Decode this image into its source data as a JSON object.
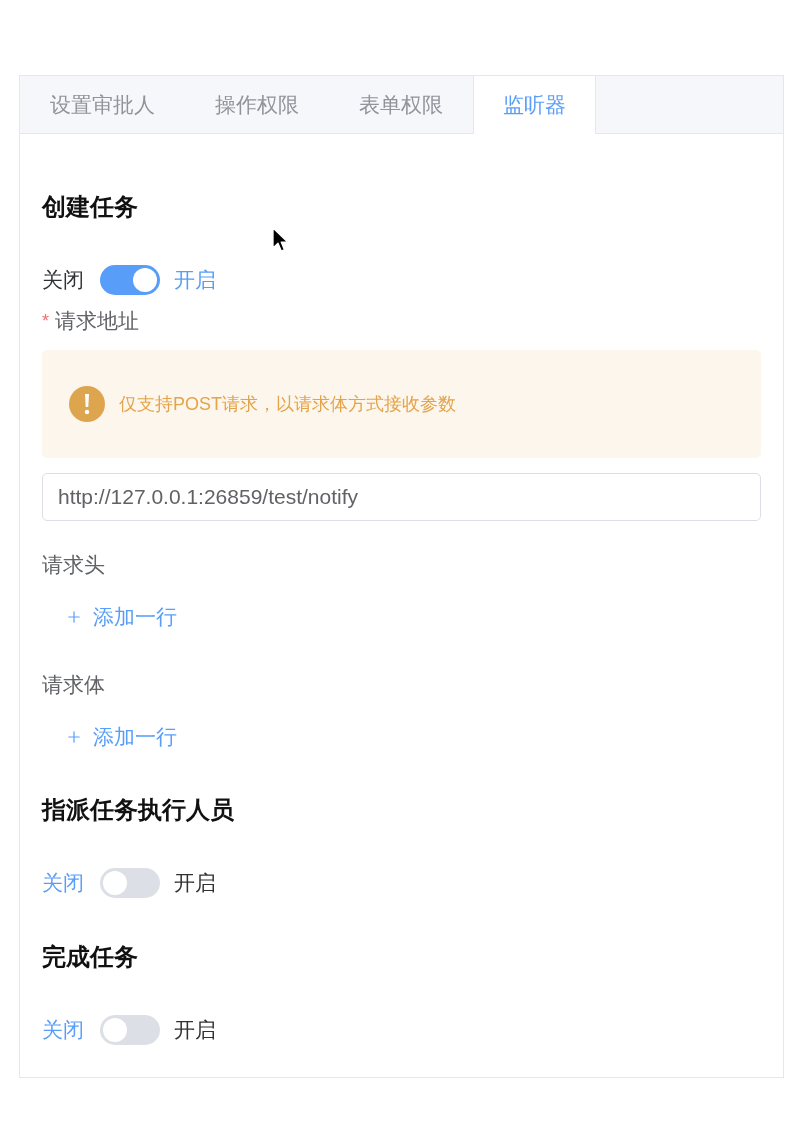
{
  "tabs": [
    {
      "label": "设置审批人",
      "selected": false
    },
    {
      "label": "操作权限",
      "selected": false
    },
    {
      "label": "表单权限",
      "selected": false
    },
    {
      "label": "监听器",
      "selected": true
    }
  ],
  "sections": [
    {
      "title": "创建任务",
      "switch": {
        "off_label": "关闭",
        "on_label": "开启",
        "on": true
      },
      "fields": [
        {
          "kind": "url",
          "required_mark": "*",
          "label": "请求地址",
          "alert": {
            "kind": "warning",
            "text": "仅支持POST请求，以请求体方式接收参数"
          },
          "value": "http://127.0.0.1:26859/test/notify"
        },
        {
          "kind": "list",
          "label": "请求头",
          "add_label": "添加一行"
        },
        {
          "kind": "list",
          "label": "请求体",
          "add_label": "添加一行"
        }
      ]
    },
    {
      "title": "指派任务执行人员",
      "switch": {
        "off_label": "关闭",
        "on_label": "开启",
        "on": false
      }
    },
    {
      "title": "完成任务",
      "switch": {
        "off_label": "关闭",
        "on_label": "开启",
        "on": false
      }
    }
  ]
}
